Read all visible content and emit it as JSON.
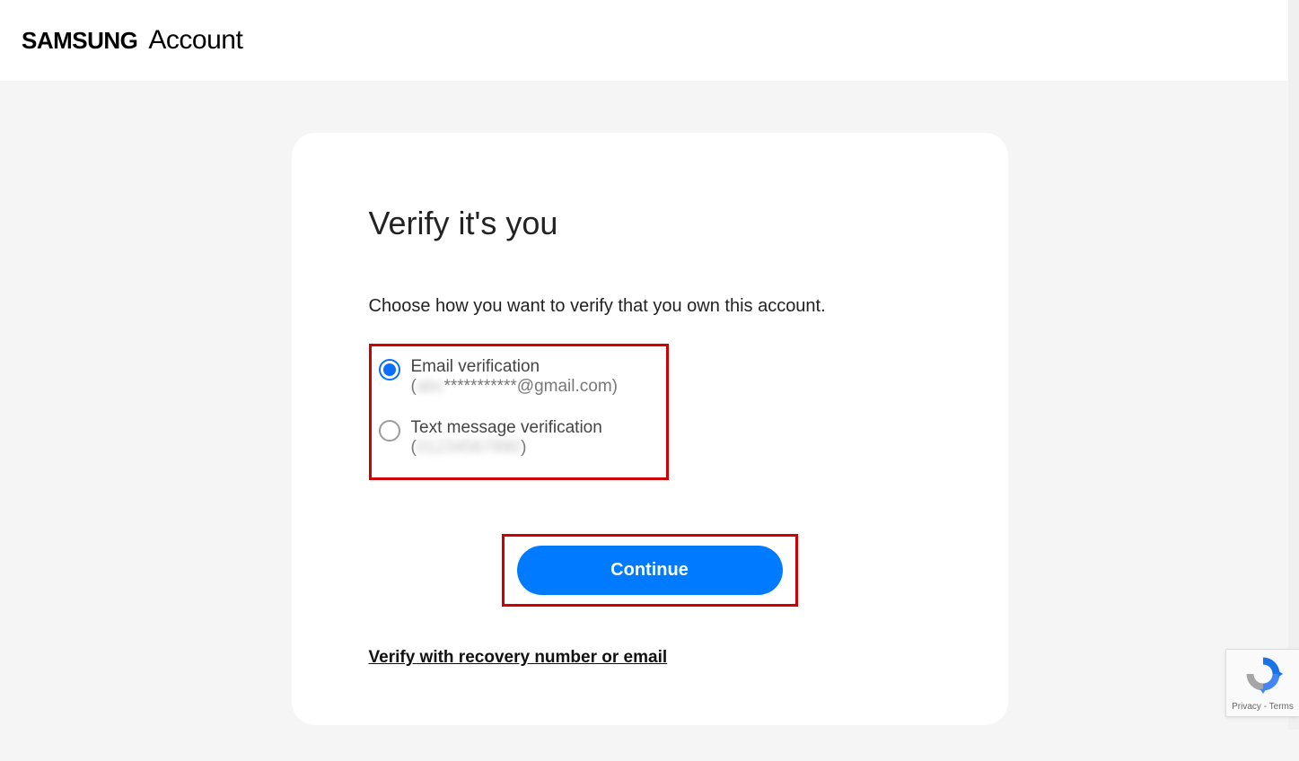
{
  "brand": {
    "samsung": "SAMSUNG",
    "account": "Account"
  },
  "card": {
    "title": "Verify it's you",
    "subtitle": "Choose how you want to verify that you own this account.",
    "options": {
      "email": {
        "label": "Email verification",
        "prefix": "(",
        "masked": "abc",
        "visible": "***********@gmail.com)",
        "selected": true
      },
      "sms": {
        "label": "Text message verification",
        "prefix": "(",
        "masked": "01234567890",
        "visible": ")",
        "selected": false
      }
    },
    "continue_label": "Continue",
    "recovery_link": "Verify with recovery number or email"
  },
  "recaptcha": {
    "privacy": "Privacy",
    "separator": " - ",
    "terms": "Terms"
  }
}
